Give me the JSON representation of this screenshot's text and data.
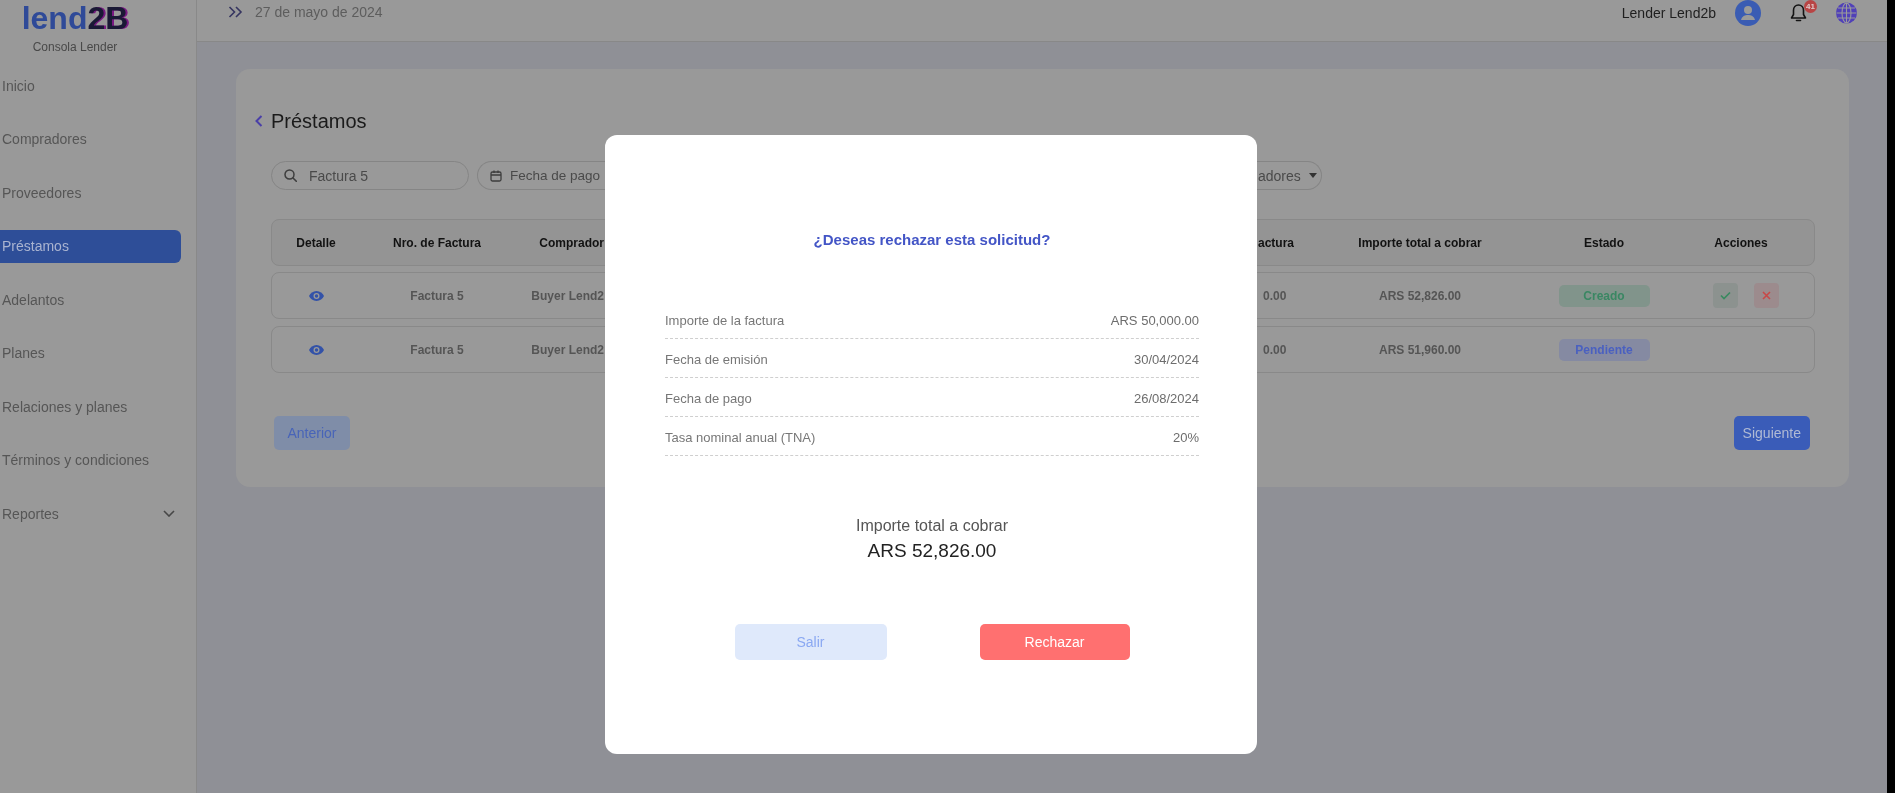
{
  "sidebar": {
    "logo": [
      "lend",
      "2B"
    ],
    "subtitle": "Consola Lender",
    "items": [
      {
        "label": "Inicio",
        "kind": "link",
        "selected": false
      },
      {
        "label": "Compradores",
        "kind": "link",
        "selected": false
      },
      {
        "label": "Proveedores",
        "kind": "link",
        "selected": false
      },
      {
        "label": "Préstamos",
        "kind": "link",
        "selected": true
      },
      {
        "label": "Adelantos",
        "kind": "link",
        "selected": false
      },
      {
        "label": "Planes",
        "kind": "link",
        "selected": false
      },
      {
        "label": "Relaciones y planes",
        "kind": "link",
        "selected": false
      },
      {
        "label": "Términos y condiciones",
        "kind": "link",
        "selected": false
      },
      {
        "label": "Reportes",
        "kind": "group",
        "selected": false
      }
    ]
  },
  "top_bar": {
    "date": "27 de mayo de 2024",
    "user_name": "Lender Lend2b",
    "notifications": "41"
  },
  "page": {
    "title": "Préstamos",
    "search": {
      "value": "Factura 5"
    },
    "date_filter": {
      "label": "Fecha de pago"
    },
    "filter_3": {
      "label": "adores"
    }
  },
  "table": {
    "columns": [
      "Detalle",
      "Nro. de Factura",
      "Comprador",
      "actura",
      "Importe total a cobrar",
      "Estado",
      "Acciones"
    ],
    "rows": [
      {
        "invoice": "Factura 5",
        "buyer": "Buyer Lend2",
        "column_5": "0.00",
        "total": "ARS 52,826.00",
        "status": {
          "label": "Creado",
          "color": "#3a8763"
        },
        "actions": [
          {
            "kind": "approve"
          },
          {
            "kind": "reject"
          }
        ]
      },
      {
        "invoice": "Factura 5",
        "buyer": "Buyer Lend2",
        "column_5": "0.00",
        "total": "ARS 51,960.00",
        "status": {
          "label": "Pendiente",
          "color": "#4a60c0"
        }
      }
    ]
  },
  "pagination": [
    {
      "label": "Anterior",
      "disabled": true
    },
    {
      "label": "Siguiente",
      "disabled": false
    }
  ],
  "modal": {
    "title": "¿Deseas rechazar esta solicitud?",
    "details": [
      {
        "label": "Importe de la factura",
        "value": "ARS 50,000.00"
      },
      {
        "label": "Fecha de emisión",
        "value": "30/04/2024"
      },
      {
        "label": "Fecha de pago",
        "value": "26/08/2024"
      },
      {
        "label": "Tasa nominal anual (TNA)",
        "value": "20%"
      }
    ],
    "total": {
      "label": "Importe total a cobrar",
      "value": "ARS 52,826.00"
    },
    "buttons": [
      {
        "label": "Salir",
        "kind": "cancel"
      },
      {
        "label": "Rechazar",
        "kind": "danger"
      }
    ]
  }
}
